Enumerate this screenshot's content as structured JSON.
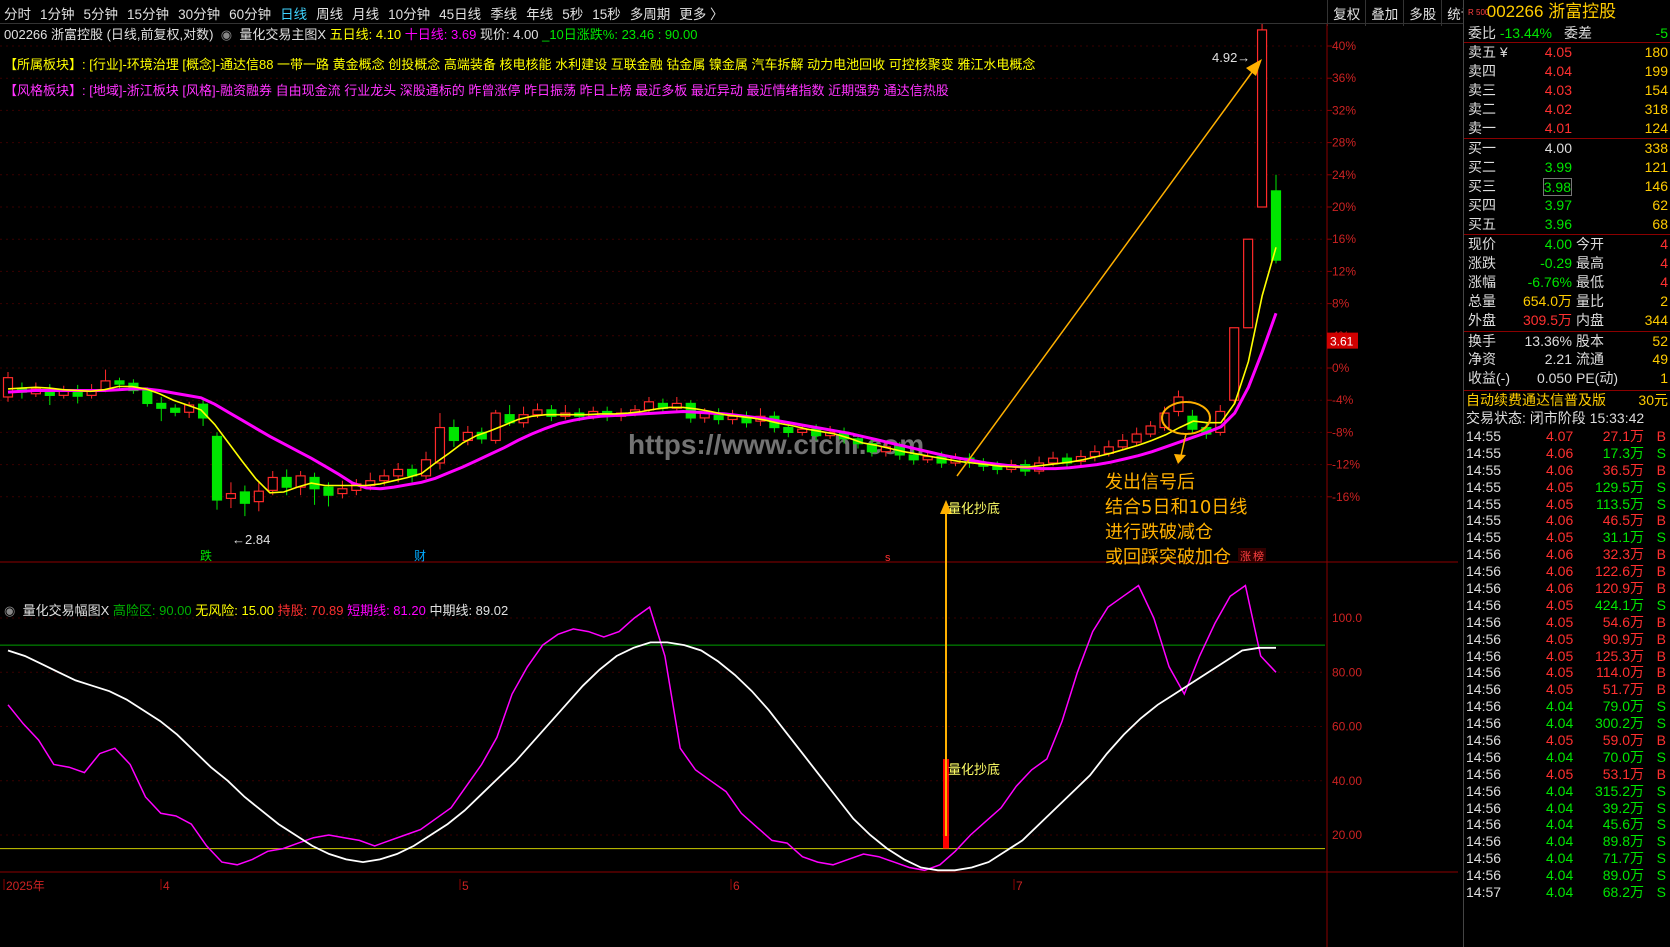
{
  "toolbar": {
    "periods": [
      "分时",
      "1分钟",
      "5分钟",
      "15分钟",
      "30分钟",
      "60分钟",
      "日线",
      "周线",
      "月线",
      "10分钟",
      "45日线",
      "季线",
      "年线",
      "5秒",
      "15秒",
      "多周期",
      "更多 〉"
    ],
    "active_period": "日线",
    "actions": [
      "复权",
      "叠加",
      "多股",
      "统计",
      "画线",
      "F10",
      "标记",
      "-自选",
      "返回"
    ]
  },
  "chart_header": {
    "stock": "002266 浙富控股 (日线,前复权,对数)",
    "indicator_name": "量化交易主图X",
    "ma5_label": "五日线: 4.10",
    "ma10_label": "十日线: 3.69",
    "price_label": "现价: 4.00",
    "change10_label": "_10日涨跌%: 23.46 : 90.00",
    "sector_label": "【所属板块】:",
    "sector_text": "[行业]-环境治理 [概念]-通达信88 一带一路 黄金概念 创投概念 高端装备 核电核能 水利建设 互联金融 钴金属 镍金属 汽车拆解 动力电池回收 可控核聚变 雅江水电概念",
    "style_label": "【风格板块】:",
    "style_text": "[地域]-浙江板块 [风格]-融资融券 自由现金流 行业龙头 深股通标的 昨曾涨停 昨日振荡 昨日上榜 最近多板 最近异动 最近情绪指数 近期强势 通达信热股"
  },
  "price_axis": [
    "44%",
    "40%",
    "36%",
    "32%",
    "28%",
    "24%",
    "20%",
    "16%",
    "12%",
    "8%",
    "4%",
    "0%",
    "-4%",
    "-8%",
    "-12%",
    "-16%"
  ],
  "current_price_tag": "3.61",
  "annotations": {
    "high_price": "4.92",
    "low_price": "2.84",
    "signal_label_top": "量化抄底",
    "signal_label_bottom": "量化抄底",
    "advice_lines": [
      "发出信号后",
      "结合5日和10日线",
      "进行跌破减仓",
      "或回踩突破加仓"
    ],
    "watermark": "https://www.cfchi.com",
    "marker_die": "跌",
    "marker_cai": "财",
    "marker_s": "s",
    "marker_zhang": "涨",
    "marker_bang": "榜"
  },
  "sub_header": {
    "name": "量化交易幅图X",
    "high_risk": "高险区: 90.00",
    "no_risk": "无风险: 15.00",
    "hold": "持股: 70.89",
    "short": "短期线: 81.20",
    "mid": "中期线: 89.02"
  },
  "sub_axis": [
    "100.0",
    "80.00",
    "60.00",
    "40.00",
    "20.00"
  ],
  "date_axis": [
    "2025年",
    "4",
    "5",
    "6",
    "7"
  ],
  "colors": {
    "up": "#ff2a2a",
    "down": "#00e600",
    "ma5": "#ffff00",
    "ma10": "#ff00ff",
    "arrow": "#ffb000",
    "short_line": "#ff00ff",
    "mid_line": "#ffffff"
  },
  "chart_data": {
    "type": "line",
    "candles": [
      {
        "o": -3.6,
        "c": -1.2,
        "h": -0.5,
        "l": -4.2
      },
      {
        "o": -2.5,
        "c": -3.0,
        "h": -1.8,
        "l": -3.8
      },
      {
        "o": -3.2,
        "c": -2.6,
        "h": -1.8,
        "l": -3.6
      },
      {
        "o": -2.8,
        "c": -3.4,
        "h": -2.0,
        "l": -4.6
      },
      {
        "o": -3.4,
        "c": -2.7,
        "h": -2.2,
        "l": -3.8
      },
      {
        "o": -2.8,
        "c": -3.5,
        "h": -2.1,
        "l": -4.4
      },
      {
        "o": -3.4,
        "c": -2.8,
        "h": -2.0,
        "l": -3.8
      },
      {
        "o": -2.8,
        "c": -1.6,
        "h": -0.2,
        "l": -3.0
      },
      {
        "o": -1.6,
        "c": -2.0,
        "h": -1.2,
        "l": -2.6
      },
      {
        "o": -1.9,
        "c": -2.8,
        "h": -1.4,
        "l": -3.2
      },
      {
        "o": -2.8,
        "c": -4.4,
        "h": -2.4,
        "l": -4.8
      },
      {
        "o": -4.4,
        "c": -5.0,
        "h": -3.6,
        "l": -6.6
      },
      {
        "o": -5.0,
        "c": -5.5,
        "h": -4.5,
        "l": -6.0
      },
      {
        "o": -5.5,
        "c": -4.6,
        "h": -4.2,
        "l": -6.2
      },
      {
        "o": -4.5,
        "c": -6.2,
        "h": -3.8,
        "l": -7.2
      },
      {
        "o": -8.5,
        "c": -16.4,
        "h": -8.0,
        "l": -17.6
      },
      {
        "o": -16.2,
        "c": -15.6,
        "h": -14.2,
        "l": -17.4
      },
      {
        "o": -15.4,
        "c": -16.8,
        "h": -14.6,
        "l": -18.4
      },
      {
        "o": -16.6,
        "c": -15.3,
        "h": -14.2,
        "l": -17.8
      },
      {
        "o": -15.2,
        "c": -13.6,
        "h": -12.8,
        "l": -15.8
      },
      {
        "o": -13.6,
        "c": -14.8,
        "h": -12.6,
        "l": -15.8
      },
      {
        "o": -14.8,
        "c": -13.4,
        "h": -12.8,
        "l": -15.8
      },
      {
        "o": -13.6,
        "c": -15.0,
        "h": -13.0,
        "l": -17.0
      },
      {
        "o": -14.8,
        "c": -15.8,
        "h": -14.2,
        "l": -17.2
      },
      {
        "o": -15.6,
        "c": -15.0,
        "h": -14.0,
        "l": -16.2
      },
      {
        "o": -15.2,
        "c": -14.4,
        "h": -13.8,
        "l": -15.8
      },
      {
        "o": -14.6,
        "c": -14.0,
        "h": -13.0,
        "l": -15.2
      },
      {
        "o": -14.0,
        "c": -13.4,
        "h": -12.6,
        "l": -14.6
      },
      {
        "o": -13.4,
        "c": -12.6,
        "h": -11.8,
        "l": -14.2
      },
      {
        "o": -12.6,
        "c": -13.4,
        "h": -12.0,
        "l": -14.2
      },
      {
        "o": -13.4,
        "c": -11.4,
        "h": -10.4,
        "l": -13.8
      },
      {
        "o": -11.8,
        "c": -7.4,
        "h": -5.6,
        "l": -12.6
      },
      {
        "o": -7.4,
        "c": -9.0,
        "h": -6.4,
        "l": -9.8
      },
      {
        "o": -9.0,
        "c": -8.0,
        "h": -7.2,
        "l": -9.6
      },
      {
        "o": -8.0,
        "c": -8.8,
        "h": -7.4,
        "l": -9.4
      },
      {
        "o": -9.0,
        "c": -5.6,
        "h": -5.2,
        "l": -9.4
      },
      {
        "o": -5.8,
        "c": -6.8,
        "h": -4.6,
        "l": -7.2
      },
      {
        "o": -6.8,
        "c": -5.8,
        "h": -4.8,
        "l": -7.4
      },
      {
        "o": -5.8,
        "c": -5.2,
        "h": -4.4,
        "l": -6.2
      },
      {
        "o": -5.2,
        "c": -6.0,
        "h": -4.6,
        "l": -6.6
      },
      {
        "o": -6.0,
        "c": -5.6,
        "h": -4.6,
        "l": -6.4
      },
      {
        "o": -5.6,
        "c": -6.0,
        "h": -5.0,
        "l": -6.6
      },
      {
        "o": -6.0,
        "c": -5.4,
        "h": -4.8,
        "l": -6.4
      },
      {
        "o": -5.4,
        "c": -6.0,
        "h": -4.8,
        "l": -6.6
      },
      {
        "o": -6.0,
        "c": -5.6,
        "h": -5.0,
        "l": -6.6
      },
      {
        "o": -5.6,
        "c": -5.2,
        "h": -4.6,
        "l": -6.0
      },
      {
        "o": -5.2,
        "c": -4.2,
        "h": -3.6,
        "l": -5.6
      },
      {
        "o": -4.4,
        "c": -5.0,
        "h": -3.8,
        "l": -5.6
      },
      {
        "o": -5.0,
        "c": -4.4,
        "h": -3.6,
        "l": -5.6
      },
      {
        "o": -4.4,
        "c": -6.2,
        "h": -4.0,
        "l": -6.8
      },
      {
        "o": -6.2,
        "c": -5.6,
        "h": -5.0,
        "l": -6.8
      },
      {
        "o": -5.6,
        "c": -6.4,
        "h": -5.0,
        "l": -7.0
      },
      {
        "o": -6.4,
        "c": -6.0,
        "h": -5.2,
        "l": -7.0
      },
      {
        "o": -6.0,
        "c": -6.8,
        "h": -5.4,
        "l": -7.4
      },
      {
        "o": -6.6,
        "c": -6.0,
        "h": -5.0,
        "l": -7.2
      },
      {
        "o": -6.0,
        "c": -7.4,
        "h": -5.4,
        "l": -8.0
      },
      {
        "o": -7.4,
        "c": -8.0,
        "h": -6.8,
        "l": -8.6
      },
      {
        "o": -8.0,
        "c": -7.6,
        "h": -7.0,
        "l": -8.4
      },
      {
        "o": -7.6,
        "c": -8.4,
        "h": -7.0,
        "l": -9.0
      },
      {
        "o": -8.4,
        "c": -8.0,
        "h": -7.2,
        "l": -8.8
      },
      {
        "o": -8.0,
        "c": -8.8,
        "h": -7.4,
        "l": -9.4
      },
      {
        "o": -8.8,
        "c": -9.4,
        "h": -8.2,
        "l": -10.0
      },
      {
        "o": -9.4,
        "c": -10.4,
        "h": -8.8,
        "l": -11.0
      },
      {
        "o": -10.4,
        "c": -9.8,
        "h": -9.2,
        "l": -11.0
      },
      {
        "o": -9.8,
        "c": -10.8,
        "h": -9.2,
        "l": -11.4
      },
      {
        "o": -10.8,
        "c": -11.4,
        "h": -10.2,
        "l": -12.0
      },
      {
        "o": -11.4,
        "c": -11.0,
        "h": -10.4,
        "l": -11.8
      },
      {
        "o": -11.0,
        "c": -11.8,
        "h": -10.4,
        "l": -12.4
      },
      {
        "o": -11.8,
        "c": -11.2,
        "h": -10.6,
        "l": -12.2
      },
      {
        "o": -11.2,
        "c": -11.8,
        "h": -10.6,
        "l": -12.4
      },
      {
        "o": -11.8,
        "c": -12.2,
        "h": -11.2,
        "l": -12.8
      },
      {
        "o": -12.2,
        "c": -12.6,
        "h": -11.6,
        "l": -13.2
      },
      {
        "o": -12.6,
        "c": -12.0,
        "h": -11.4,
        "l": -13.0
      },
      {
        "o": -12.0,
        "c": -12.8,
        "h": -11.4,
        "l": -13.4
      },
      {
        "o": -12.8,
        "c": -11.8,
        "h": -11.0,
        "l": -13.2
      },
      {
        "o": -11.8,
        "c": -11.2,
        "h": -10.4,
        "l": -12.2
      },
      {
        "o": -11.2,
        "c": -11.8,
        "h": -10.6,
        "l": -12.4
      },
      {
        "o": -11.6,
        "c": -11.0,
        "h": -10.2,
        "l": -12.2
      },
      {
        "o": -11.0,
        "c": -10.4,
        "h": -9.6,
        "l": -11.6
      },
      {
        "o": -10.6,
        "c": -9.8,
        "h": -9.0,
        "l": -11.0
      },
      {
        "o": -9.8,
        "c": -9.0,
        "h": -8.2,
        "l": -10.2
      },
      {
        "o": -9.2,
        "c": -8.2,
        "h": -7.4,
        "l": -9.6
      },
      {
        "o": -8.2,
        "c": -7.2,
        "h": -6.6,
        "l": -8.6
      },
      {
        "o": -7.4,
        "c": -5.6,
        "h": -4.8,
        "l": -7.8
      },
      {
        "o": -5.4,
        "c": -3.6,
        "h": -2.8,
        "l": -6.0
      },
      {
        "o": -6.0,
        "c": -7.6,
        "h": -5.2,
        "l": -8.0
      },
      {
        "o": -7.4,
        "c": -8.2,
        "h": -6.8,
        "l": -8.8
      },
      {
        "o": -8.0,
        "c": -5.4,
        "h": -4.6,
        "l": -8.4
      },
      {
        "o": -4.0,
        "c": 5.0,
        "h": 5.0,
        "l": -4.6
      },
      {
        "o": 5.0,
        "c": 16.0,
        "h": 16.0,
        "l": 5.0
      },
      {
        "o": 20.0,
        "c": 42.0,
        "h": 43.8,
        "l": 20.0
      },
      {
        "o": 22.0,
        "c": 13.4,
        "h": 24.0,
        "l": 13.0
      }
    ],
    "ma5": [
      -2.6,
      -2.5,
      -2.4,
      -2.5,
      -2.7,
      -2.8,
      -2.9,
      -2.7,
      -2.3,
      -2.3,
      -2.6,
      -3.2,
      -4.0,
      -4.6,
      -5.2,
      -7.0,
      -9.3,
      -11.6,
      -13.8,
      -15.5,
      -15.4,
      -14.8,
      -14.3,
      -14.6,
      -14.6,
      -14.6,
      -14.6,
      -14.4,
      -14.0,
      -13.6,
      -13.1,
      -11.8,
      -10.6,
      -9.3,
      -8.4,
      -7.8,
      -7.1,
      -6.4,
      -6.0,
      -5.8,
      -5.8,
      -5.8,
      -5.8,
      -5.7,
      -5.7,
      -5.6,
      -5.4,
      -5.1,
      -4.9,
      -4.9,
      -5.1,
      -5.4,
      -5.8,
      -6.0,
      -6.2,
      -6.5,
      -6.9,
      -7.2,
      -7.6,
      -7.9,
      -8.2,
      -8.7,
      -9.3,
      -9.6,
      -10.0,
      -10.4,
      -10.7,
      -11.0,
      -11.3,
      -11.6,
      -11.8,
      -12.0,
      -12.2,
      -12.3,
      -12.3,
      -12.1,
      -11.9,
      -11.7,
      -11.4,
      -11.0,
      -10.6,
      -10.1,
      -9.6,
      -9.0,
      -8.3,
      -7.4,
      -6.6,
      -6.8,
      -6.8,
      -4.4,
      0.8,
      9.0,
      15.0
    ],
    "ma10": [
      -3.0,
      -2.9,
      -2.8,
      -2.8,
      -2.8,
      -2.8,
      -2.8,
      -2.8,
      -2.7,
      -2.6,
      -2.6,
      -2.8,
      -3.1,
      -3.4,
      -3.7,
      -4.5,
      -5.5,
      -6.5,
      -7.5,
      -8.5,
      -9.4,
      -10.3,
      -11.2,
      -12.2,
      -13.2,
      -14.3,
      -14.9,
      -15.0,
      -14.8,
      -14.5,
      -14.2,
      -13.7,
      -13.0,
      -12.3,
      -11.5,
      -10.7,
      -9.9,
      -9.0,
      -8.2,
      -7.5,
      -6.9,
      -6.5,
      -6.2,
      -6.0,
      -5.9,
      -5.8,
      -5.7,
      -5.6,
      -5.5,
      -5.4,
      -5.5,
      -5.6,
      -5.7,
      -5.9,
      -6.1,
      -6.3,
      -6.6,
      -6.9,
      -7.2,
      -7.5,
      -7.8,
      -8.1,
      -8.5,
      -8.9,
      -9.3,
      -9.7,
      -10.1,
      -10.5,
      -10.9,
      -11.2,
      -11.5,
      -11.8,
      -12.0,
      -12.2,
      -12.4,
      -12.5,
      -12.5,
      -12.4,
      -12.2,
      -12.0,
      -11.7,
      -11.3,
      -10.9,
      -10.4,
      -9.8,
      -9.2,
      -8.6,
      -8.0,
      -7.3,
      -5.6,
      -2.4,
      2.0,
      6.8
    ],
    "sub_short": [
      68,
      61,
      55,
      46,
      45,
      43,
      50,
      52,
      46,
      34,
      28,
      27,
      24,
      16,
      10,
      9,
      11,
      14,
      15,
      17,
      19,
      20,
      19,
      18,
      16,
      18,
      20,
      22,
      26,
      30,
      38,
      46,
      56,
      72,
      82,
      90,
      94,
      96,
      95,
      93,
      95,
      100,
      104,
      86,
      52,
      44,
      40,
      36,
      28,
      23,
      18,
      17,
      12,
      10,
      9,
      11,
      13,
      12,
      10,
      8,
      7,
      9,
      14,
      20,
      25,
      30,
      38,
      44,
      48,
      62,
      80,
      95,
      104,
      108,
      112,
      100,
      82,
      72,
      86,
      98,
      108,
      112,
      86,
      80
    ],
    "sub_mid": [
      88,
      86,
      83,
      80,
      77,
      75,
      73,
      70,
      66,
      62,
      57,
      51,
      45,
      40,
      34,
      29,
      24,
      20,
      16,
      13,
      11,
      10,
      11,
      13,
      16,
      20,
      24,
      29,
      35,
      41,
      47,
      54,
      61,
      68,
      75,
      81,
      86,
      89,
      91,
      91,
      90,
      88,
      84,
      79,
      73,
      66,
      58,
      50,
      42,
      34,
      26,
      20,
      15,
      11,
      8,
      7,
      7,
      8,
      10,
      14,
      18,
      24,
      30,
      36,
      42,
      50,
      57,
      63,
      68,
      72,
      76,
      80,
      84,
      88,
      89,
      89
    ]
  },
  "quote_panel": {
    "title": "002266 浙富控股",
    "badge": "R 500",
    "webi": {
      "label": "委比",
      "value": "-13.44%",
      "label2": "委差",
      "value2": "-5"
    },
    "sells": [
      {
        "label": "卖五 ¥",
        "price": "4.05",
        "vol": "180"
      },
      {
        "label": "卖四",
        "price": "4.04",
        "vol": "199"
      },
      {
        "label": "卖三",
        "price": "4.03",
        "vol": "154"
      },
      {
        "label": "卖二",
        "price": "4.02",
        "vol": "318"
      },
      {
        "label": "卖一",
        "price": "4.01",
        "vol": "124"
      }
    ],
    "buys": [
      {
        "label": "买一",
        "price": "4.00",
        "vol": "338"
      },
      {
        "label": "买二",
        "price": "3.99",
        "vol": "121"
      },
      {
        "label": "买三",
        "price": "3.98",
        "vol": "146"
      },
      {
        "label": "买四",
        "price": "3.97",
        "vol": "62"
      },
      {
        "label": "买五",
        "price": "3.96",
        "vol": "68"
      }
    ],
    "stats": [
      {
        "l1": "现价",
        "v1": "4.00",
        "l2": "今开",
        "v2": "4"
      },
      {
        "l1": "涨跌",
        "v1": "-0.29",
        "l2": "最高",
        "v2": "4"
      },
      {
        "l1": "涨幅",
        "v1": "-6.76%",
        "l2": "最低",
        "v2": "4"
      },
      {
        "l1": "总量",
        "v1": "654.0万",
        "l2": "量比",
        "v2": "2"
      },
      {
        "l1": "外盘",
        "v1": "309.5万",
        "l2": "内盘",
        "v2": "344"
      },
      {
        "l1": "换手",
        "v1": "13.36%",
        "l2": "股本",
        "v2": "52"
      },
      {
        "l1": "净资",
        "v1": "2.21",
        "l2": "流通",
        "v2": "49"
      },
      {
        "l1": "收益(-)",
        "v1": "0.050",
        "l2": "PE(动)",
        "v2": "1"
      }
    ],
    "promo": "自动续费通达信普及版",
    "promo_price": "30元",
    "status": "交易状态: 闭市阶段 15:33:42",
    "ticks": [
      {
        "t": "14:55",
        "p": "4.07",
        "v": "27.1万",
        "s": "B"
      },
      {
        "t": "14:55",
        "p": "4.06",
        "v": "17.3万",
        "s": "S"
      },
      {
        "t": "14:55",
        "p": "4.06",
        "v": "36.5万",
        "s": "B"
      },
      {
        "t": "14:55",
        "p": "4.05",
        "v": "129.5万",
        "s": "S"
      },
      {
        "t": "14:55",
        "p": "4.05",
        "v": "113.5万",
        "s": "S"
      },
      {
        "t": "14:55",
        "p": "4.06",
        "v": "46.5万",
        "s": "B"
      },
      {
        "t": "14:55",
        "p": "4.05",
        "v": "31.1万",
        "s": "S"
      },
      {
        "t": "14:56",
        "p": "4.06",
        "v": "32.3万",
        "s": "B"
      },
      {
        "t": "14:56",
        "p": "4.06",
        "v": "122.6万",
        "s": "B"
      },
      {
        "t": "14:56",
        "p": "4.06",
        "v": "120.9万",
        "s": "B"
      },
      {
        "t": "14:56",
        "p": "4.05",
        "v": "424.1万",
        "s": "S"
      },
      {
        "t": "14:56",
        "p": "4.05",
        "v": "54.6万",
        "s": "B"
      },
      {
        "t": "14:56",
        "p": "4.05",
        "v": "90.9万",
        "s": "B"
      },
      {
        "t": "14:56",
        "p": "4.05",
        "v": "125.3万",
        "s": "B"
      },
      {
        "t": "14:56",
        "p": "4.05",
        "v": "114.0万",
        "s": "B"
      },
      {
        "t": "14:56",
        "p": "4.05",
        "v": "51.7万",
        "s": "B"
      },
      {
        "t": "14:56",
        "p": "4.04",
        "v": "79.0万",
        "s": "S"
      },
      {
        "t": "14:56",
        "p": "4.04",
        "v": "300.2万",
        "s": "S"
      },
      {
        "t": "14:56",
        "p": "4.05",
        "v": "59.0万",
        "s": "B"
      },
      {
        "t": "14:56",
        "p": "4.04",
        "v": "70.0万",
        "s": "S"
      },
      {
        "t": "14:56",
        "p": "4.05",
        "v": "53.1万",
        "s": "B"
      },
      {
        "t": "14:56",
        "p": "4.04",
        "v": "315.2万",
        "s": "S"
      },
      {
        "t": "14:56",
        "p": "4.04",
        "v": "39.2万",
        "s": "S"
      },
      {
        "t": "14:56",
        "p": "4.04",
        "v": "45.6万",
        "s": "S"
      },
      {
        "t": "14:56",
        "p": "4.04",
        "v": "89.8万",
        "s": "S"
      },
      {
        "t": "14:56",
        "p": "4.04",
        "v": "71.7万",
        "s": "S"
      },
      {
        "t": "14:56",
        "p": "4.04",
        "v": "89.0万",
        "s": "S"
      },
      {
        "t": "14:57",
        "p": "4.04",
        "v": "68.2万",
        "s": "S"
      }
    ]
  }
}
